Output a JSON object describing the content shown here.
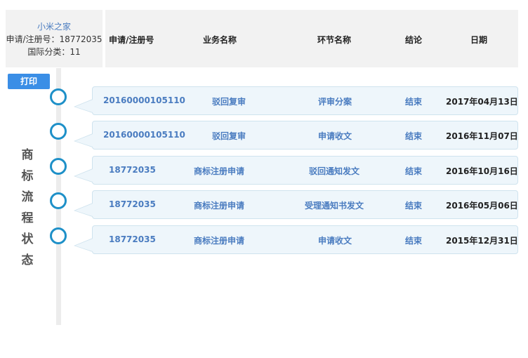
{
  "info": {
    "name": "小米之家",
    "reg_line": "申请/注册号：18772035",
    "class_line": "国际分类：11"
  },
  "columns": {
    "reg_no": "申请/注册号",
    "business": "业务名称",
    "step": "环节名称",
    "result": "结论",
    "date": "日期"
  },
  "print_label": "打印",
  "side_title": [
    "商",
    "标",
    "流",
    "程",
    "状",
    "态"
  ],
  "rows": [
    {
      "reg_no": "20160000105110",
      "business": "驳回复审",
      "step": "评审分案",
      "result": "结束",
      "date": "2017年04月13日"
    },
    {
      "reg_no": "20160000105110",
      "business": "驳回复审",
      "step": "申请收文",
      "result": "结束",
      "date": "2016年11月07日"
    },
    {
      "reg_no": "18772035",
      "business": "商标注册申请",
      "step": "驳回通知发文",
      "result": "结束",
      "date": "2016年10月16日"
    },
    {
      "reg_no": "18772035",
      "business": "商标注册申请",
      "step": "受理通知书发文",
      "result": "结束",
      "date": "2016年05月06日"
    },
    {
      "reg_no": "18772035",
      "business": "商标注册申请",
      "step": "申请收文",
      "result": "结束",
      "date": "2015年12月31日"
    }
  ]
}
